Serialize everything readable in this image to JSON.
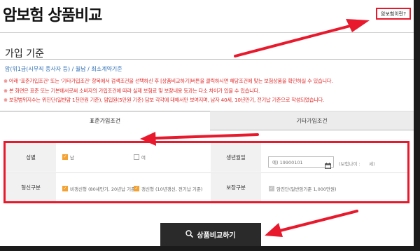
{
  "header": {
    "title": "암보험 상품비교",
    "help_link": "암보험이란?"
  },
  "section": {
    "title": "가입 기준",
    "criteria": "암(위1급(시무직 종사자 등) / 월납 / 최소계약기준",
    "notes": [
      "※ 아래 '표준가입조건' 또는 '기타가입조건' 항목에서 검색조건을 선택하신 후 [상품비교하기]버튼을 클릭하시면 해당조건에 맞는 보험상품을 확인하실 수 있습니다.",
      "※ 본 화면은 표준 또는 기본에서로써 소비자의 가입조건에 따라 실제 보험료 및 보장내용 등과는 다소 차이가 있을 수 있습니다.",
      "※ 보장범위지수는 위진단(일반암 1천만원 기준), 암입원(5만원 기준) 담보 각각에 대해서만 보여지며, 남자 40세, 10년만기, 전기납 기준으로 작성되었습니다."
    ]
  },
  "tabs": [
    {
      "label": "표준가입조건",
      "active": true
    },
    {
      "label": "기타가입조건",
      "active": false
    }
  ],
  "form": {
    "gender": {
      "label": "성별",
      "options": [
        {
          "label": "남",
          "checked": true
        },
        {
          "label": "여",
          "checked": false
        }
      ]
    },
    "birth": {
      "label": "생년월일",
      "placeholder": "예) 19900101",
      "age_note": "(보험나이 :",
      "age_unit": "세)"
    },
    "type": {
      "label": "형신구분",
      "options": [
        {
          "label": "비갱신형 (80세만기, 20년납 기준)",
          "checked": true
        },
        {
          "label": "갱신형 (10년갱신, 전기납 기준)",
          "checked": true
        }
      ]
    },
    "guarantee": {
      "label": "보장구분",
      "options": [
        {
          "label": "암진단(일반암기준 1,000만원)",
          "checked": true,
          "disabled": true
        }
      ]
    }
  },
  "search_button": {
    "label": "상품비교하기",
    "icon": "search-icon"
  },
  "colors": {
    "accent": "#f3a233",
    "highlight": "#e8192c",
    "note_red": "#e02c2c",
    "link_blue": "#2e6db4",
    "button": "#2a2a2a"
  }
}
